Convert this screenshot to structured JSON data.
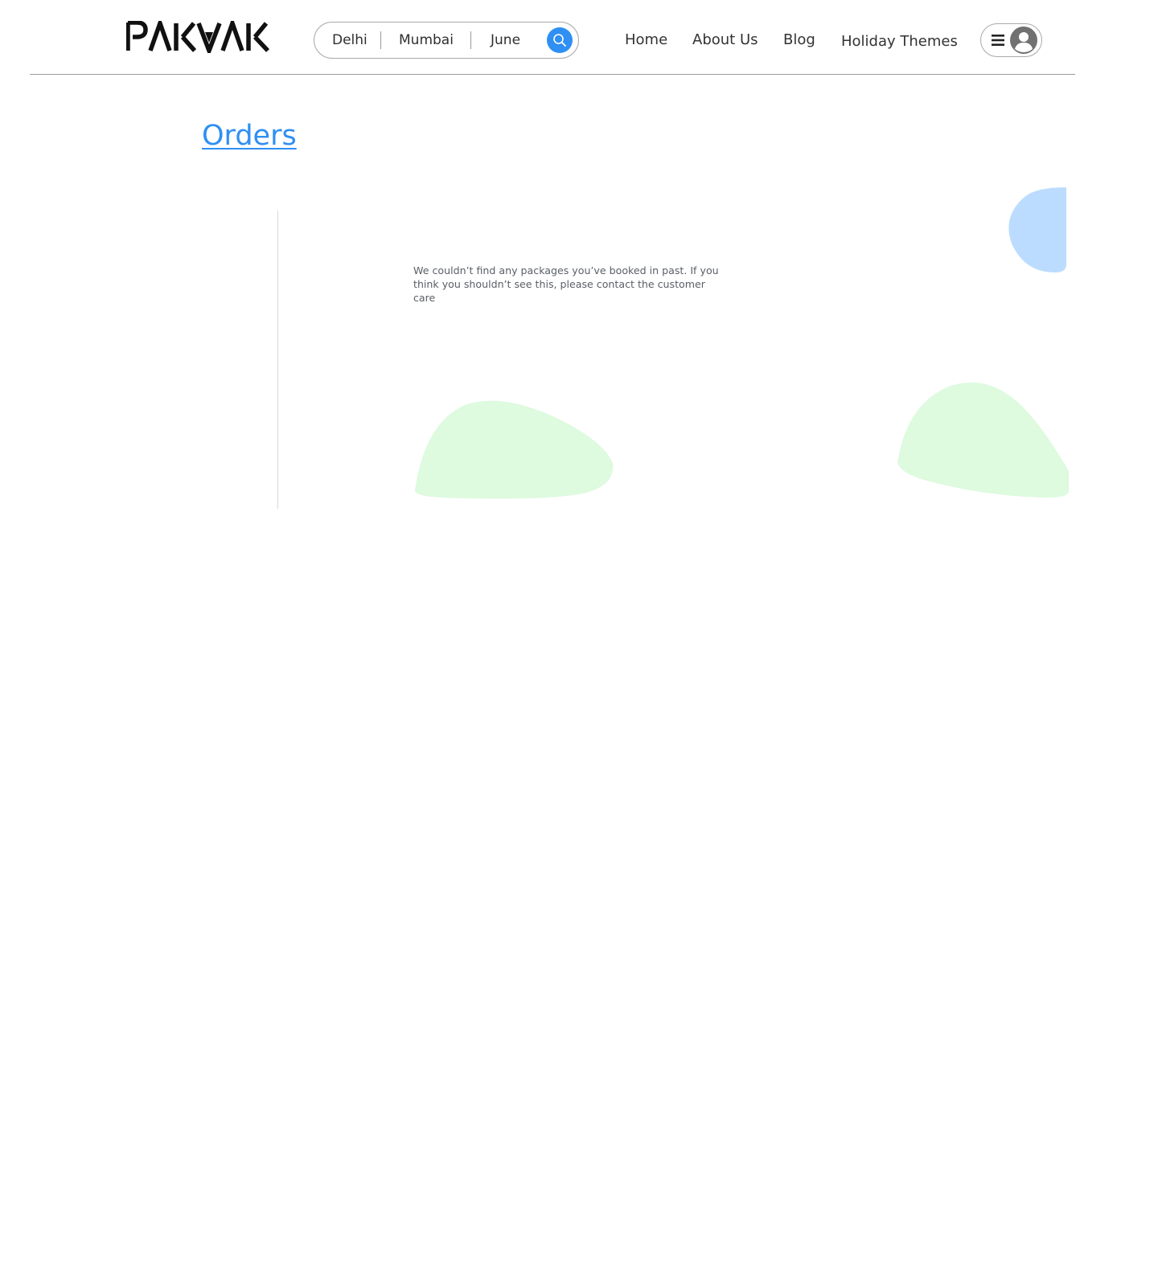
{
  "brand": {
    "logo_text": "PAKVAK"
  },
  "search": {
    "from": "Delhi",
    "to": "Mumbai",
    "month": "June",
    "icon": "search-icon"
  },
  "nav": {
    "home": "Home",
    "about": "About Us",
    "blog": "Blog",
    "themes": "Holiday Themes"
  },
  "account": {
    "menu_icon": "hamburger-menu-icon",
    "avatar_icon": "user-avatar-icon"
  },
  "page": {
    "title": "Orders",
    "empty_message": "We couldn’t  find any packages you’ve booked in past. If you think you shouldn’t see this, please contact the customer care"
  },
  "colors": {
    "accent": "#2f8ff3",
    "blob_blue": "#bcdcff",
    "blob_green": "#defadf",
    "text_dark": "#333333",
    "divider": "#9c9c9c"
  }
}
